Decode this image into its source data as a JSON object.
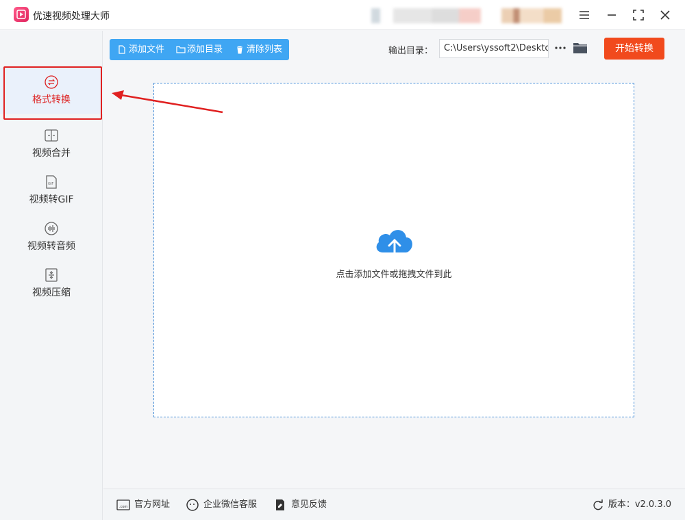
{
  "app": {
    "title": "优速视频处理大师"
  },
  "sidebar": {
    "items": [
      {
        "label": "格式转换",
        "icon": "format-convert-icon",
        "active": true
      },
      {
        "label": "视频合并",
        "icon": "video-merge-icon",
        "active": false
      },
      {
        "label": "视频转GIF",
        "icon": "gif-icon",
        "active": false
      },
      {
        "label": "视频转音频",
        "icon": "audio-icon",
        "active": false
      },
      {
        "label": "视频压缩",
        "icon": "compress-icon",
        "active": false
      }
    ]
  },
  "toolbar": {
    "add_file": "添加文件",
    "add_dir": "添加目录",
    "clear_list": "清除列表",
    "output_label": "输出目录：",
    "output_path": "C:\\Users\\yssoft2\\Deskto",
    "start_button": "开始转换"
  },
  "drop_zone": {
    "text": "点击添加文件或拖拽文件到此"
  },
  "footer": {
    "website": "官方网址",
    "wechat": "企业微信客服",
    "feedback": "意见反馈",
    "version": "版本：v2.0.3.0"
  },
  "colors": {
    "accent": "#3fa6f3",
    "start": "#f14a1d",
    "highlight": "#e02020"
  }
}
